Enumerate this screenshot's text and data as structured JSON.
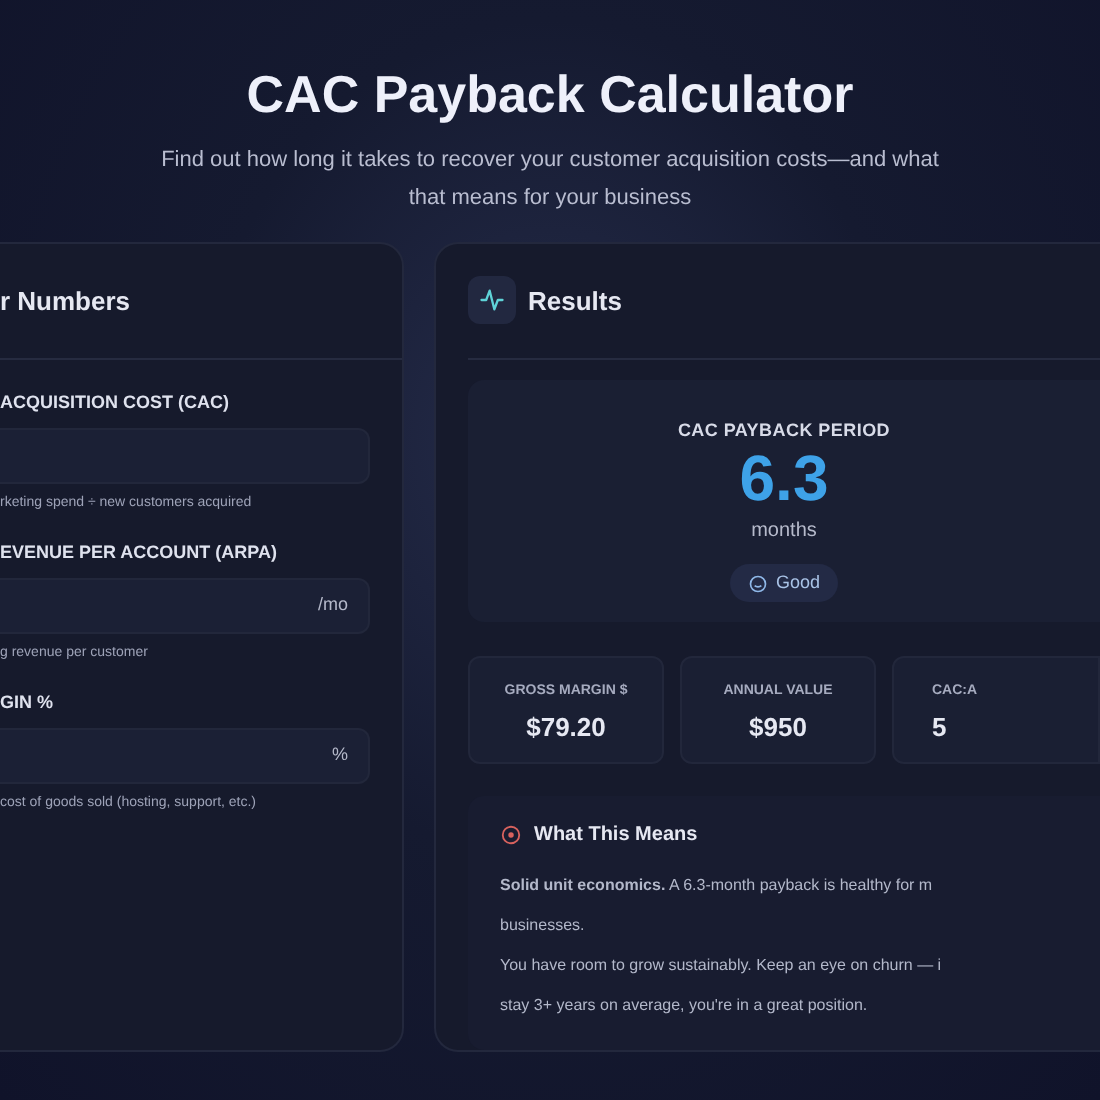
{
  "header": {
    "title": "CAC Payback Calculator",
    "subtitle_lines": [
      "Find out how long it takes to recover your customer acquisition costs—and what",
      "that means for your business"
    ]
  },
  "inputs_panel": {
    "title": "r Numbers",
    "fields": [
      {
        "label": "ACQUISITION COST (CAC)",
        "hint": "rketing spend ÷ new customers acquired"
      },
      {
        "label": "EVENUE PER ACCOUNT (ARPA)",
        "suffix": "/mo",
        "hint": "g revenue per customer"
      },
      {
        "label": "GIN %",
        "suffix": "%",
        "hint": "cost of goods sold (hosting, support, etc.)"
      }
    ]
  },
  "results_panel": {
    "title": "Results",
    "payback": {
      "label": "CAC PAYBACK PERIOD",
      "value": "6.3",
      "unit": "months",
      "rating": "Good"
    },
    "metrics": [
      {
        "label": "GROSS MARGIN $",
        "value": "$79.20"
      },
      {
        "label": "ANNUAL VALUE",
        "value": "$950"
      },
      {
        "label": "CAC:A",
        "value": "5"
      }
    ],
    "meaning": {
      "title": "What This Means",
      "paragraphs": [
        {
          "lines": [
            "**Solid unit economics.** A 6.3-month payback is healthy for m",
            "businesses."
          ]
        },
        {
          "lines": [
            "You have room to grow sustainably. Keep an eye on churn — i",
            "stay 3+ years on average, you're in a great position."
          ]
        }
      ]
    }
  }
}
